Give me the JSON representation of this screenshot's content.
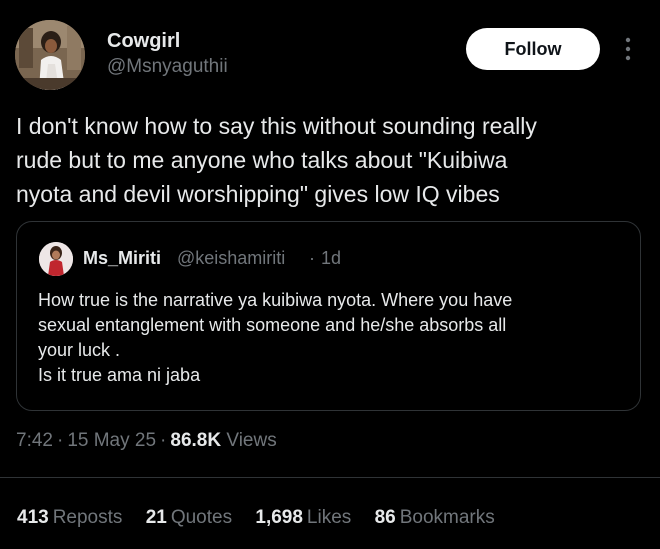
{
  "author": {
    "display_name": "Cowgirl",
    "handle": "@Msnyaguthii",
    "follow_label": "Follow"
  },
  "tweet": {
    "text": "I don't know how to say this without sounding really\nrude but to me anyone who talks about \"Kuibiwa\nnyota and devil worshipping\" gives low IQ vibes"
  },
  "quote": {
    "display_name": "Ms_Miriti",
    "handle": "@keishamiriti",
    "separator": "·",
    "time": "1d",
    "text": "How true is the narrative ya kuibiwa nyota. Where you have\nsexual entanglement with someone and he/she absorbs all\nyour luck .\nIs it true ama ni jaba"
  },
  "meta": {
    "time": "7:42",
    "date": "15 May 25",
    "separator": "·",
    "views_count": "86.8K",
    "views_label": "Views"
  },
  "stats": {
    "reposts_count": "413",
    "reposts_label": "Reposts",
    "quotes_count": "21",
    "quotes_label": "Quotes",
    "likes_count": "1,698",
    "likes_label": "Likes",
    "bookmarks_count": "86",
    "bookmarks_label": "Bookmarks"
  },
  "icons": {
    "more": "more-vertical-icon"
  },
  "colors": {
    "background": "#000000",
    "primary_text": "#e7e9ea",
    "secondary_text": "#71767b",
    "border": "#2f3336",
    "follow_bg": "#ffffff",
    "follow_text": "#0f1419"
  }
}
